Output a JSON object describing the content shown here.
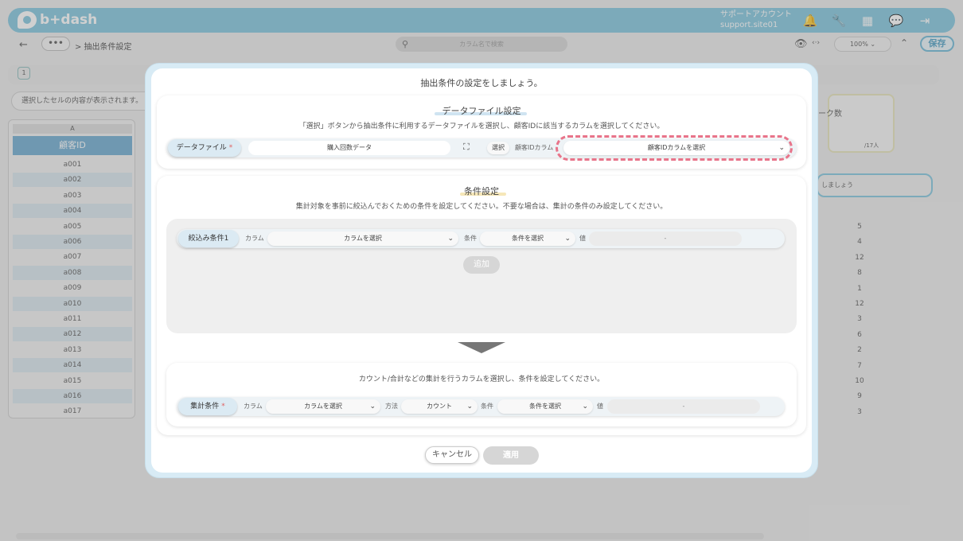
{
  "header": {
    "logo": "b+dash",
    "account_line1": "サポートアカウント",
    "account_line2": "support.site01"
  },
  "toolbar": {
    "back": "←",
    "more": "•••",
    "breadcrumb": "> 抽出条件設定",
    "search_placeholder": "カラム名で検索",
    "view_toggle": "‹·›",
    "zoom": "100%",
    "save": "保存"
  },
  "sheet": {
    "column_letter": "A",
    "column_header": "顧客ID",
    "rows": [
      "a001",
      "a002",
      "a003",
      "a004",
      "a005",
      "a006",
      "a007",
      "a008",
      "a009",
      "a010",
      "a011",
      "a012",
      "a013",
      "a014",
      "a015",
      "a016",
      "a017"
    ],
    "right_values": [
      "5",
      "4",
      "12",
      "8",
      "1",
      "12",
      "3",
      "6",
      "2",
      "7",
      "10",
      "9",
      "3"
    ],
    "hint": "選択したセルの内容が表示されます。"
  },
  "side_panel": {
    "label": "ーク数",
    "count": "/17人",
    "input": "しましょう"
  },
  "modal": {
    "title": "抽出条件の設定をしましょう。",
    "datafile": {
      "title": "データファイル設定",
      "desc": "「選択」ボタンから抽出条件に利用するデータファイルを選択し、顧客IDに該当するカラムを選択してください。",
      "label": "データファイル",
      "required": "*",
      "file_value": "購入回数データ",
      "select_btn": "選択",
      "id_col_label": "顧客IDカラム",
      "id_col_select": "顧客IDカラムを選択"
    },
    "condition": {
      "title": "条件設定",
      "desc": "集計対象を事前に絞込んでおくための条件を設定してください。不要な場合は、集計の条件のみ設定してください。",
      "filter_label": "絞込み条件1",
      "column_label": "カラム",
      "column_select": "カラムを選択",
      "cond_label": "条件",
      "cond_select": "条件を選択",
      "value_label": "値",
      "value_placeholder": "-",
      "add_btn": "追加"
    },
    "aggregate": {
      "desc": "カウント/合計などの集計を行うカラムを選択し、条件を設定してください。",
      "label": "集計条件",
      "required": "*",
      "column_label": "カラム",
      "column_select": "カラムを選択",
      "method_label": "方法",
      "method_select": "カウント",
      "cond_label": "条件",
      "cond_select": "条件を選択",
      "value_label": "値",
      "value_placeholder": "-"
    },
    "cancel": "キャンセル",
    "apply": "適用"
  }
}
